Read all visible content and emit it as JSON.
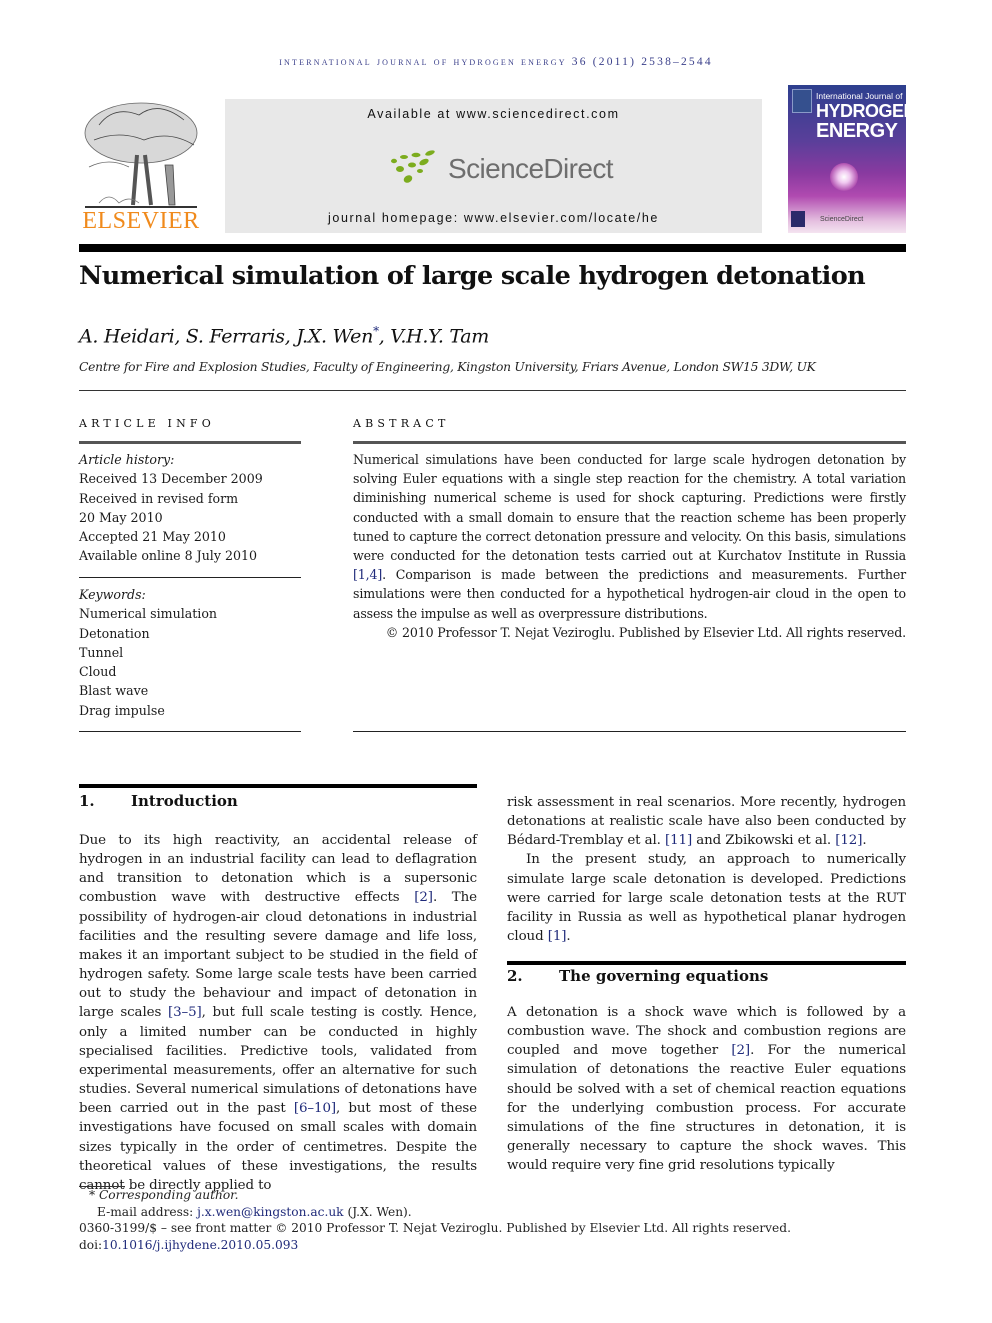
{
  "running_head": "INTERNATIONAL JOURNAL OF HYDROGEN ENERGY 36 (2011) 2538–2544",
  "publisher": {
    "logo_icon": "elsevier-tree-icon",
    "name": "ELSEVIER"
  },
  "banner": {
    "available_at": "Available at www.sciencedirect.com",
    "logo_icon": "sciencedirect-dots-icon",
    "logo_text": "ScienceDirect",
    "homepage": "journal homepage: www.elsevier.com/locate/he",
    "accent_color": "#7cac1e"
  },
  "cover": {
    "title_line1": "International Journal of",
    "title_line2": "HYDROGEN",
    "title_line3": "ENERGY",
    "footer": "ScienceDirect"
  },
  "article": {
    "title": "Numerical simulation of large scale hydrogen detonation",
    "authors": [
      "A. Heidari, ",
      "S. Ferraris, ",
      "J.X. Wen",
      ", V.H.Y. Tam"
    ],
    "corresponding_mark": "*",
    "affiliation": "Centre for Fire and Explosion Studies, Faculty of Engineering, Kingston University, Friars Avenue, London SW15 3DW, UK"
  },
  "article_info": {
    "label": "ARTICLE INFO",
    "history_label": "Article history:",
    "history": [
      "Received 13 December 2009",
      "Received in revised form",
      "20 May 2010",
      "Accepted 21 May 2010",
      "Available online 8 July 2010"
    ],
    "keywords_label": "Keywords:",
    "keywords": [
      "Numerical simulation",
      "Detonation",
      "Tunnel",
      "Cloud",
      "Blast wave",
      "Drag impulse"
    ]
  },
  "abstract": {
    "label": "ABSTRACT",
    "text_a": "Numerical simulations have been conducted for large scale hydrogen detonation by solving Euler equations with a single step reaction for the chemistry. A total variation diminishing numerical scheme is used for shock capturing. Predictions were firstly conducted with a small domain to ensure that the reaction scheme has been properly tuned to capture the correct detonation pressure and velocity. On this basis, simulations were conducted for the detonation tests carried out at Kurchatov Institute in Russia ",
    "ref_a": "[1,4]",
    "text_b": ". Comparison is made between the predictions and measurements. Further simulations were then conducted for a hypothetical hydrogen-air cloud in the open to assess the impulse as well as overpressure distributions.",
    "copyright": "© 2010 Professor T. Nejat Veziroglu. Published by Elsevier Ltd. All rights reserved."
  },
  "sections": [
    {
      "number": "1.",
      "title": "Introduction",
      "left_column": [
        "Due to its high reactivity, an accidental release of hydrogen in an industrial facility can lead to deflagration and transition to detonation which is a supersonic combustion wave with destructive effects ",
        "[2]",
        ". The possibility of hydrogen-air cloud detonations in industrial facilities and the resulting severe damage and life loss, makes it an important subject to be studied in the field of hydrogen safety. Some large scale tests have been carried out to study the behaviour and impact of detonation in large scales ",
        "[3–5]",
        ", but full scale testing is costly. Hence, only a limited number can be conducted in highly specialised facilities. Predictive tools, validated from experimental measurements, offer an alternative for such studies. Several numerical simulations of detonations have been carried out in the past ",
        "[6–10]",
        ", but most of these investigations have focused on small scales with domain sizes typically in the order of centimetres. Despite the theoretical values of these investigations, the results cannot be directly applied to"
      ],
      "right_column_p1": [
        "risk assessment in real scenarios. More recently, hydrogen detonations at realistic scale have also been conducted by Bédard-Tremblay et al. ",
        "[11]",
        " and Zbikowski et al. ",
        "[12]",
        "."
      ],
      "right_column_p2": [
        "In the present study, an approach to numerically simulate large scale detonation is developed. Predictions were carried for large scale detonation tests at the RUT facility in Russia as well as hypothetical planar hydrogen cloud ",
        "[1]",
        "."
      ]
    },
    {
      "number": "2.",
      "title": "The governing equations",
      "body": [
        "A detonation is a shock wave which is followed by a combustion wave. The shock and combustion regions are coupled and move together ",
        "[2]",
        ". For the numerical simulation of detonations the reactive Euler equations should be solved with a set of chemical reaction equations for the underlying combustion process. For accurate simulations of the fine structures in detonation, it is generally necessary to capture the shock waves. This would require very fine grid resolutions typically"
      ]
    }
  ],
  "footnotes": {
    "corresponding": "Corresponding author.",
    "email_label": "E-mail address: ",
    "email": "j.x.wen@kingston.ac.uk",
    "email_suffix": " (J.X. Wen).",
    "front_matter": "0360-3199/$ – see front matter © 2010 Professor T. Nejat Veziroglu. Published by Elsevier Ltd. All rights reserved.",
    "doi_label": "doi:",
    "doi": "10.1016/j.ijhydene.2010.05.093"
  }
}
